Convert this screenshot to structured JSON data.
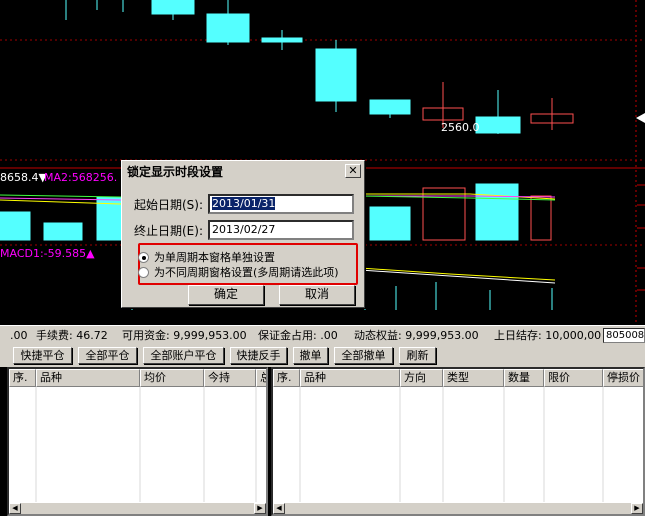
{
  "chart": {
    "price_annotation": "2560.0",
    "ma_labels": [
      {
        "text": "8658.4▼",
        "color": "#ffffff"
      },
      {
        "text": "MA2:568256.",
        "color": "#ff00ff"
      }
    ],
    "macd_label": {
      "text": "MACD1:-59.585▲",
      "color": "#ff00ff"
    },
    "colors": {
      "up": "#ff5050",
      "down": "#54ffff",
      "grid": "#a00000",
      "axis": "#c00000"
    }
  },
  "dialog": {
    "title": "锁定显示时段设置",
    "close_label": "✕",
    "start_label": "起始日期(S):",
    "start_value": "2013/01/31",
    "end_label": "终止日期(E):",
    "end_value": "2013/02/27",
    "radio_options": [
      {
        "label": "为单周期本窗格单独设置",
        "selected": true
      },
      {
        "label": "为不同周期窗格设置(多周期请选此项)",
        "selected": false
      }
    ],
    "ok_label": "确定",
    "cancel_label": "取消"
  },
  "status": {
    "lead": ".00",
    "fee": "手续费: 46.72",
    "available": "可用资金: 9,999,953.00",
    "margin": "保证金占用: .00",
    "equity": "动态权益: 9,999,953.00",
    "prev_settle": "上日结存: 10,000,00",
    "account": "805008"
  },
  "toolbar": {
    "buttons": [
      "快捷平仓",
      "全部平仓",
      "全部账户平仓",
      "快捷反手",
      "撤单",
      "全部撤单",
      "刷新"
    ]
  },
  "positions_table": {
    "columns": [
      "序.",
      "品种",
      "均价",
      "今持",
      "总"
    ]
  },
  "orders_table": {
    "columns": [
      "序.",
      "品种",
      "方向",
      "类型",
      "数量",
      "限价",
      "停损价"
    ]
  }
}
